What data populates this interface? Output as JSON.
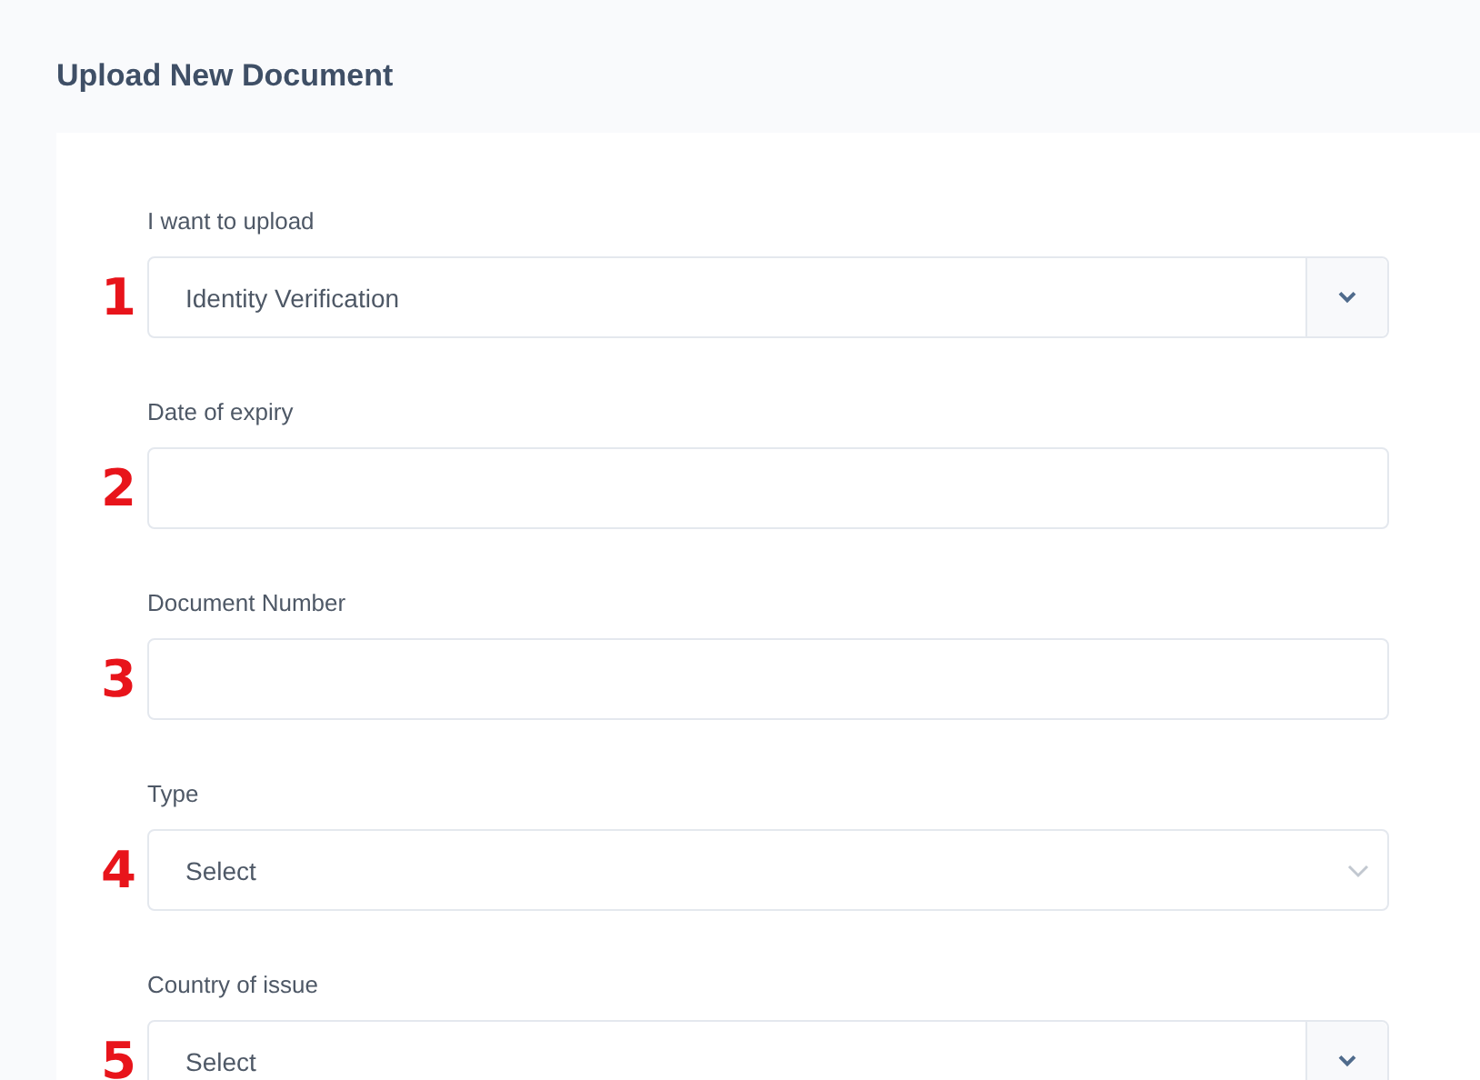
{
  "page_title": "Upload New Document",
  "fields": [
    {
      "number": "1",
      "label": "I want to upload",
      "kind": "select-addon",
      "value": "Identity Verification"
    },
    {
      "number": "2",
      "label": "Date of expiry",
      "kind": "text"
    },
    {
      "number": "3",
      "label": "Document Number",
      "kind": "text"
    },
    {
      "number": "4",
      "label": "Type",
      "kind": "select",
      "value": "Select"
    },
    {
      "number": "5",
      "label": "Country of issue",
      "kind": "select-addon",
      "value": "Select"
    }
  ]
}
